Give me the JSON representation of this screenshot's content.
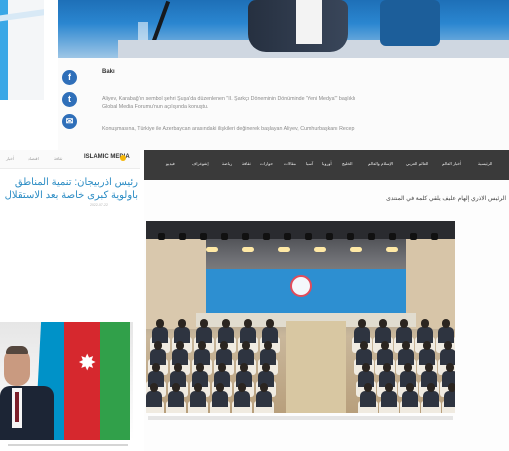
{
  "top_article": {
    "city": "Bakı",
    "line1": "Aliyev, Karabağ'ın sembol şehri Şuşa'da düzenlenen \"II. Şarkçı Döneminin Dönüminde 'Yeni Medya'\" başlıklı",
    "line2": "Global Media Forumu'nun açılışında konuştu.",
    "line3": "Konuşmasına, Türkiye ile Azerbaycan arasındaki ilişkileri değinerek başlayan Aliyev, Cumhurbaşkanı Recep",
    "share_icons": [
      "facebook-icon",
      "twitter-icon",
      "email-icon"
    ]
  },
  "middle_left": {
    "logo": "ISLAMIC MEDIA",
    "nav_items": [
      "أخبار",
      "اقتصاد",
      "ثقافة"
    ],
    "title_line1": "رئيس اذربيجان: تنمية المناطق",
    "title_line2": "باولوية كبرى خاصة بعد الاستقلال",
    "date": "2022-07-22"
  },
  "right_article": {
    "nav_items": [
      "الرئيسية",
      "أخبار العالم",
      "العالم العربي",
      "الإسلام والعالم",
      "الخليج",
      "أوروبا",
      "آسيا",
      "مقالات",
      "حوارات",
      "ثقافة",
      "رياضة",
      "إنفوغراف",
      "فيديو"
    ],
    "heading": "الرئيس الاذري إلهام عليف يلقي كلمة في المنتدى"
  },
  "colors": {
    "share_blue": "#2f6fb9",
    "title_blue": "#2b8cc4",
    "nav_dark": "#3a3a3a",
    "stage_blue": "#2d8fd1"
  }
}
